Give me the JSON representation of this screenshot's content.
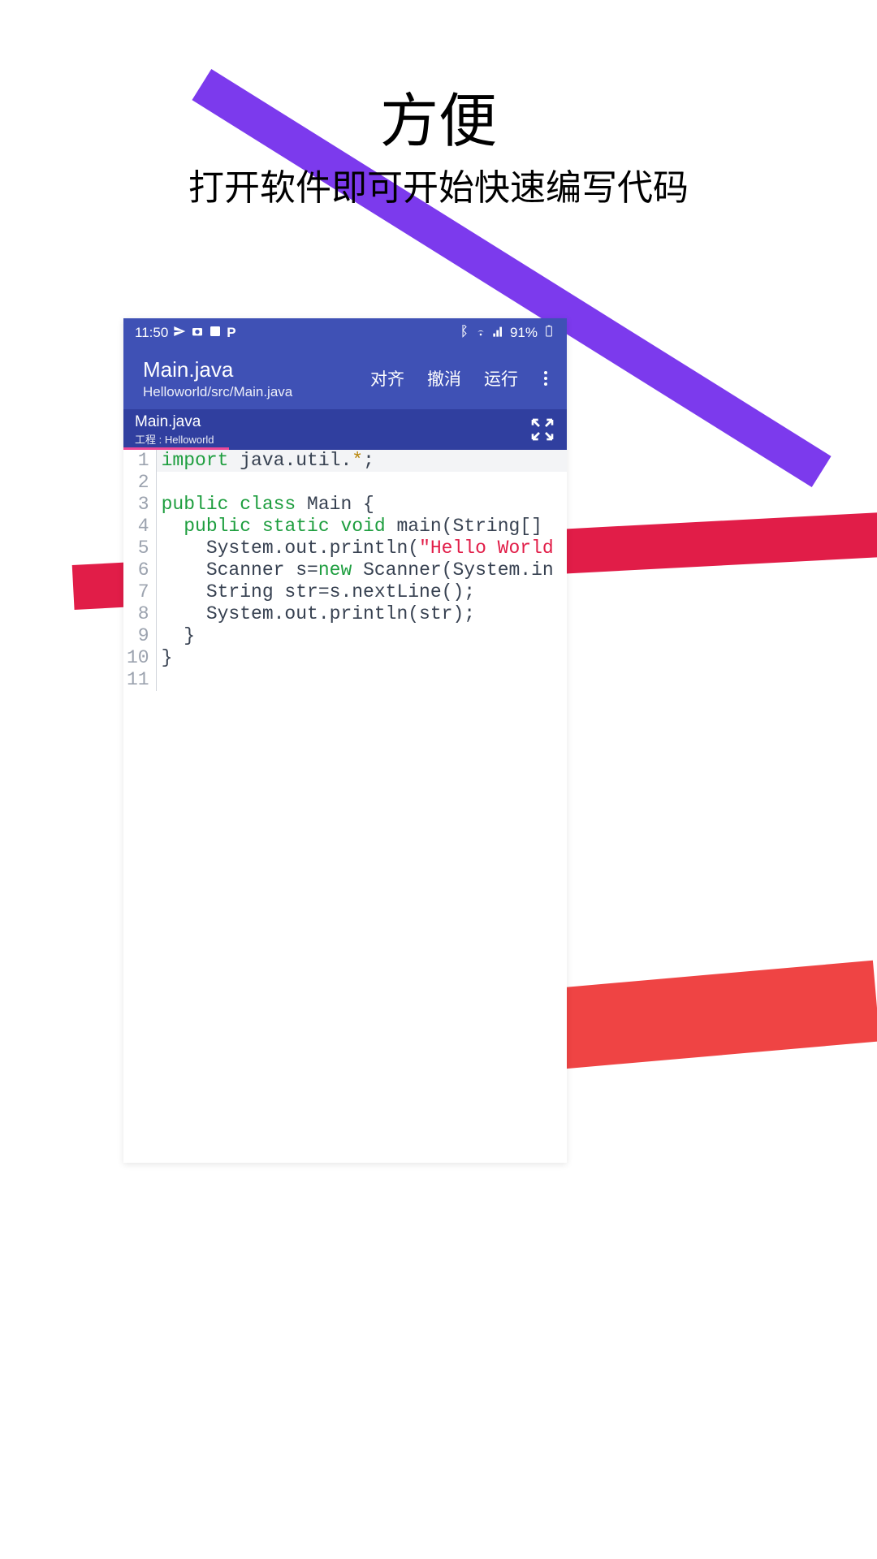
{
  "promo": {
    "title": "方便",
    "subtitle": "打开软件即可开始快速编写代码"
  },
  "statusbar": {
    "time": "11:50",
    "battery": "91%"
  },
  "appbar": {
    "title": "Main.java",
    "path": "Helloworld/src/Main.java",
    "actions": {
      "align": "对齐",
      "undo": "撤消",
      "run": "运行"
    }
  },
  "tab": {
    "name": "Main.java",
    "project_label": "工程 : Helloworld"
  },
  "code": {
    "line_numbers": [
      "1",
      "2",
      "3",
      "4",
      "5",
      "6",
      "7",
      "8",
      "9",
      "10",
      "11"
    ],
    "lines": [
      {
        "tokens": [
          {
            "t": "import ",
            "c": "kw"
          },
          {
            "t": "java.util.",
            "c": ""
          },
          {
            "t": "*",
            "c": "sym"
          },
          {
            "t": ";",
            "c": ""
          }
        ],
        "current": true
      },
      {
        "tokens": [],
        "current": false
      },
      {
        "tokens": [
          {
            "t": "public class ",
            "c": "kw"
          },
          {
            "t": "Main {",
            "c": ""
          }
        ],
        "current": false
      },
      {
        "tokens": [
          {
            "t": "  ",
            "c": ""
          },
          {
            "t": "public static void ",
            "c": "kw"
          },
          {
            "t": "main(String[]",
            "c": ""
          }
        ],
        "current": false
      },
      {
        "tokens": [
          {
            "t": "    System.out.println(",
            "c": ""
          },
          {
            "t": "\"Hello World",
            "c": "str"
          }
        ],
        "current": false
      },
      {
        "tokens": [
          {
            "t": "    Scanner s=",
            "c": ""
          },
          {
            "t": "new ",
            "c": "kw"
          },
          {
            "t": "Scanner(System.in",
            "c": ""
          }
        ],
        "current": false
      },
      {
        "tokens": [
          {
            "t": "    String str=s.nextLine();",
            "c": ""
          }
        ],
        "current": false
      },
      {
        "tokens": [
          {
            "t": "    System.out.println(str);",
            "c": ""
          }
        ],
        "current": false
      },
      {
        "tokens": [
          {
            "t": "  }",
            "c": ""
          }
        ],
        "current": false
      },
      {
        "tokens": [
          {
            "t": "}",
            "c": ""
          }
        ],
        "current": false
      },
      {
        "tokens": [],
        "current": false
      }
    ]
  }
}
